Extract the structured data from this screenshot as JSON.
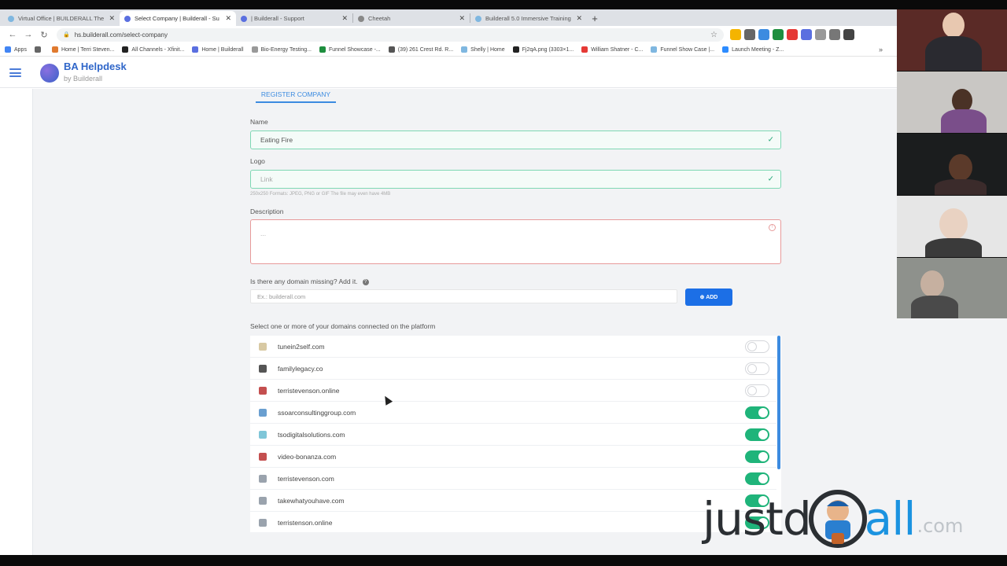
{
  "browser": {
    "tabs": [
      {
        "label": "Virtual Office | BUILDERALL The",
        "active": false,
        "favicon_color": "#7fb7e0"
      },
      {
        "label": "Select Company | Builderall - Su",
        "active": true,
        "favicon_color": "#5a6fe0"
      },
      {
        "label": "| Builderall - Support",
        "active": false,
        "favicon_color": "#5a6fe0"
      },
      {
        "label": "Cheetah",
        "active": false,
        "favicon_color": "#888888"
      },
      {
        "label": "Builderall 5.0 Immersive Training",
        "active": false,
        "favicon_color": "#7fb7e0"
      }
    ],
    "url": "hs.builderall.com/select-company",
    "bookmarks": [
      {
        "label": "Apps",
        "color": "#4285f4"
      },
      {
        "label": "",
        "color": "#666666"
      },
      {
        "label": "Home | Terri Steven...",
        "color": "#e07a2f"
      },
      {
        "label": "All Channels - Xfinit...",
        "color": "#222222"
      },
      {
        "label": "Home | Builderall",
        "color": "#5a6fe0"
      },
      {
        "label": "Bio-Energy Testing...",
        "color": "#999999"
      },
      {
        "label": "Funnel Showcase -...",
        "color": "#1e8e3e"
      },
      {
        "label": "(39) 261 Crest Rd. R...",
        "color": "#555555"
      },
      {
        "label": "Shelly | Home",
        "color": "#7fb7e0"
      },
      {
        "label": "Fj2qA.png (3303×1...",
        "color": "#222222"
      },
      {
        "label": "William Shatner - C...",
        "color": "#e53935"
      },
      {
        "label": "Funnel Show Case |...",
        "color": "#7fb7e0"
      },
      {
        "label": "Launch Meeting - Z...",
        "color": "#2d8cff"
      }
    ]
  },
  "app": {
    "title": "BA Helpdesk",
    "subtitle": "by Builderall"
  },
  "form": {
    "tab_label": "REGISTER COMPANY",
    "name_label": "Name",
    "name_value": "Eating Fire",
    "logo_label": "Logo",
    "logo_placeholder": "Link",
    "logo_hint": "250x250 Formats: JPEG, PNG or GIF The file may even have 4MB",
    "description_label": "Description",
    "description_value": "...",
    "domain_question": "Is there any domain missing? Add it.",
    "domain_placeholder": "Ex.: builderall.com",
    "add_button": "⊕ ADD",
    "domains_label": "Select one or more of your domains connected on the platform"
  },
  "domains": [
    {
      "name": "tunein2self.com",
      "enabled": false,
      "icon_color": "#d8c9a3"
    },
    {
      "name": "familylegacy.co",
      "enabled": false,
      "icon_color": "#555555"
    },
    {
      "name": "terristevenson.online",
      "enabled": false,
      "icon_color": "#c44f4f"
    },
    {
      "name": "ssoarconsultinggroup.com",
      "enabled": true,
      "icon_color": "#6a9fd0"
    },
    {
      "name": "tsodigitalsolutions.com",
      "enabled": true,
      "icon_color": "#7fc6d8"
    },
    {
      "name": "video-bonanza.com",
      "enabled": true,
      "icon_color": "#c44f4f"
    },
    {
      "name": "terristevenson.com",
      "enabled": true,
      "icon_color": "#9aa3ad"
    },
    {
      "name": "takewhatyouhave.com",
      "enabled": true,
      "icon_color": "#9aa3ad"
    },
    {
      "name": "terristenson.online",
      "enabled": true,
      "icon_color": "#9aa3ad"
    }
  ],
  "watermark": {
    "part1": "justd",
    "part2": "all",
    "part3": ".com"
  }
}
